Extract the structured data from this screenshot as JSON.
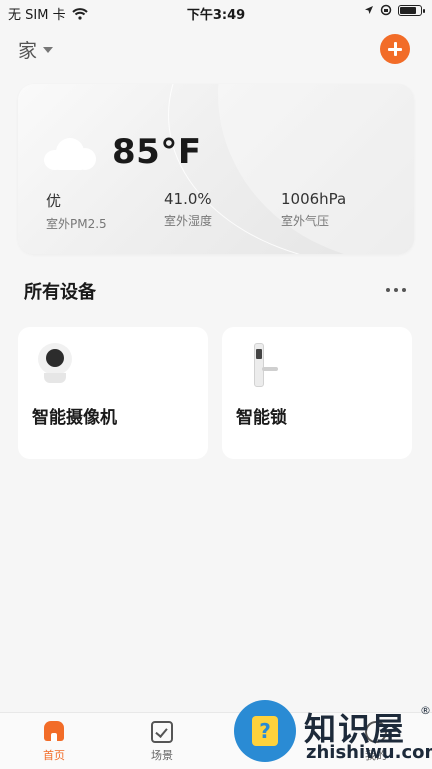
{
  "status_bar": {
    "carrier": "无 SIM 卡",
    "time": "下午3:49",
    "wifi_icon": "wifi-icon",
    "battery_level": 0.85
  },
  "header": {
    "home_name": "家",
    "add_icon": "plus-icon"
  },
  "weather": {
    "icon": "cloud-icon",
    "temperature": "85°F",
    "stats": [
      {
        "value": "优",
        "label": "室外PM2.5"
      },
      {
        "value": "41.0%",
        "label": "室外湿度"
      },
      {
        "value": "1006hPa",
        "label": "室外气压"
      }
    ]
  },
  "devices_section": {
    "title": "所有设备",
    "more_icon": "more-dots-icon",
    "devices": [
      {
        "name": "智能摄像机",
        "icon": "camera-icon"
      },
      {
        "name": "智能锁",
        "icon": "smart-lock-icon"
      }
    ]
  },
  "tabbar": {
    "tabs": [
      {
        "label": "首页",
        "icon": "home-icon",
        "active": true
      },
      {
        "label": "场景",
        "icon": "scene-check-icon",
        "active": false
      },
      {
        "label": "我的",
        "icon": "profile-icon",
        "active": false
      }
    ]
  },
  "watermark": {
    "text_cn": "知识屋",
    "text_en": "zhishiwu.com",
    "reg": "®"
  },
  "colors": {
    "accent": "#f26c28",
    "background": "#f6f6f6",
    "card": "#ffffff"
  }
}
